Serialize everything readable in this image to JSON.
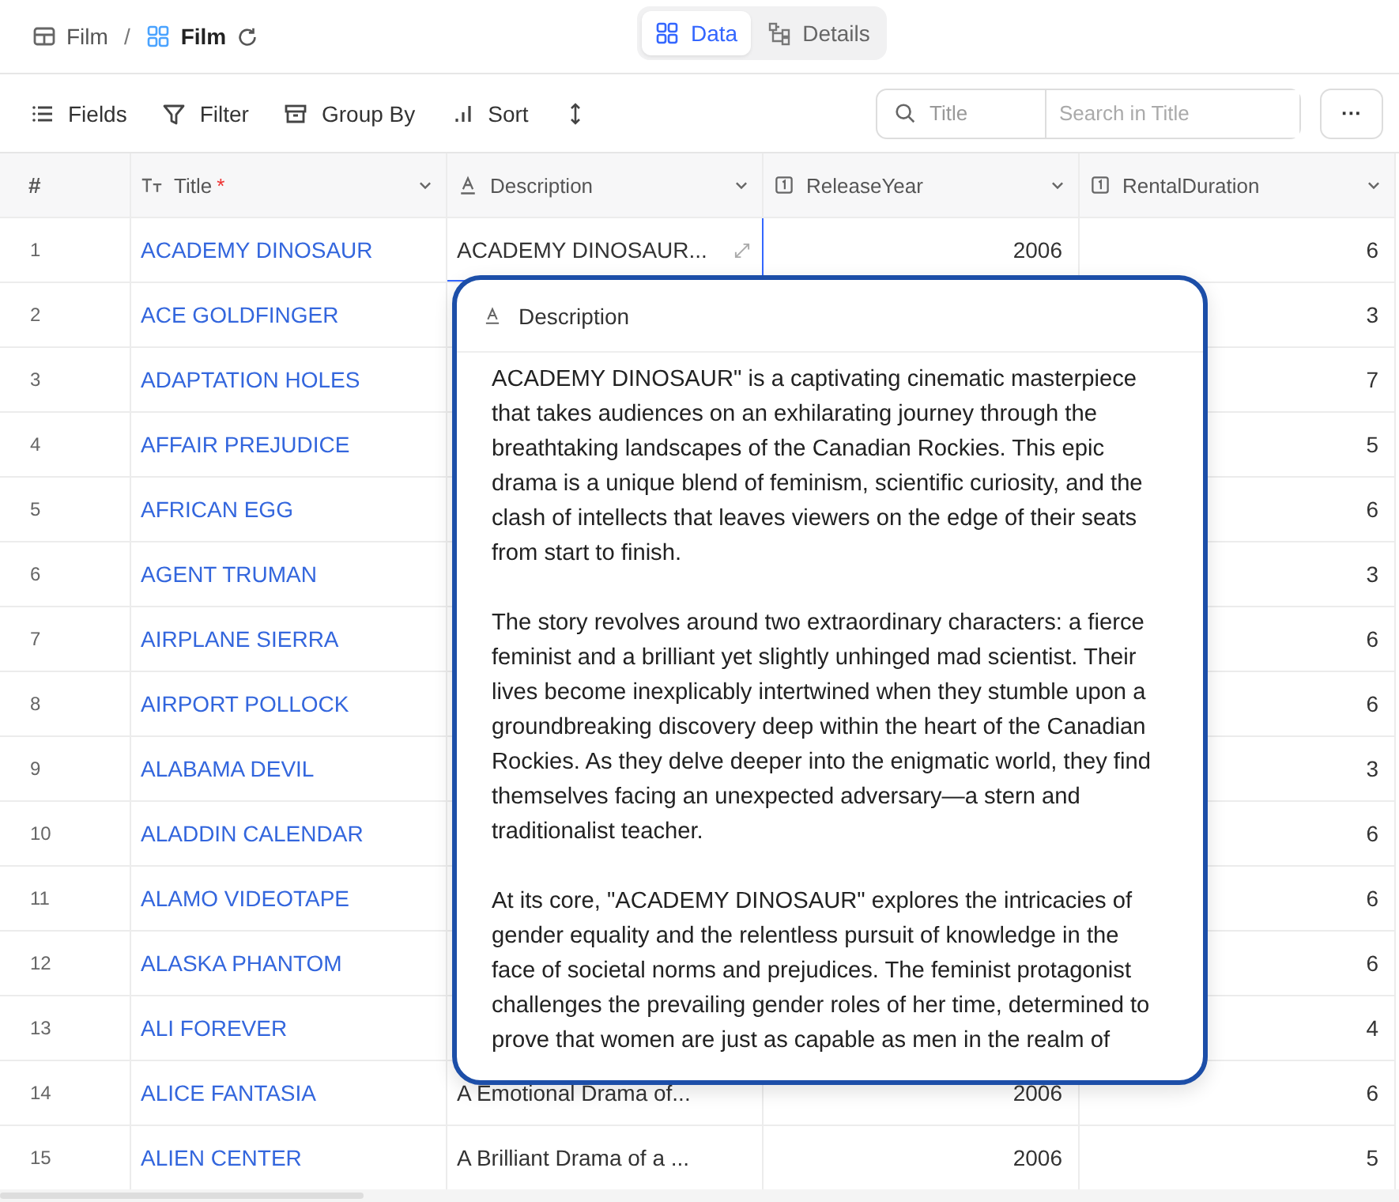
{
  "breadcrumb": {
    "parent": "Film",
    "separator": "/",
    "current": "Film"
  },
  "tabs": [
    {
      "label": "Data",
      "selected": true
    },
    {
      "label": "Details",
      "selected": false
    }
  ],
  "toolbar": [
    "Fields",
    "Filter",
    "Group By",
    "Sort"
  ],
  "search": {
    "field": "Title",
    "placeholder": "Search in Title",
    "more": "···"
  },
  "table": {
    "columns": [
      {
        "label": "#",
        "kind": "index"
      },
      {
        "label": "Title",
        "kind": "title",
        "required": "*"
      },
      {
        "label": "Description",
        "kind": "text"
      },
      {
        "label": "ReleaseYear",
        "kind": "number"
      },
      {
        "label": "RentalDuration",
        "kind": "number"
      }
    ],
    "rows": [
      {
        "num": "1",
        "title": "ACADEMY DINOSAUR",
        "description": "ACADEMY DINOSAUR...",
        "release_year": "2006",
        "rental_duration": "6",
        "selected": true
      },
      {
        "num": "2",
        "title": "ACE GOLDFINGER",
        "rental_duration": "3",
        "selected": false
      },
      {
        "num": "3",
        "title": "ADAPTATION HOLES",
        "rental_duration": "7",
        "selected": false
      },
      {
        "num": "4",
        "title": "AFFAIR PREJUDICE",
        "rental_duration": "5",
        "selected": false
      },
      {
        "num": "5",
        "title": "AFRICAN EGG",
        "rental_duration": "6",
        "selected": false
      },
      {
        "num": "6",
        "title": "AGENT TRUMAN",
        "rental_duration": "3",
        "selected": false
      },
      {
        "num": "7",
        "title": "AIRPLANE SIERRA",
        "rental_duration": "6",
        "selected": false
      },
      {
        "num": "8",
        "title": "AIRPORT POLLOCK",
        "rental_duration": "6",
        "selected": false
      },
      {
        "num": "9",
        "title": "ALABAMA DEVIL",
        "rental_duration": "3",
        "selected": false
      },
      {
        "num": "10",
        "title": "ALADDIN CALENDAR",
        "rental_duration": "6",
        "selected": false
      },
      {
        "num": "11",
        "title": "ALAMO VIDEOTAPE",
        "rental_duration": "6",
        "selected": false
      },
      {
        "num": "12",
        "title": "ALASKA PHANTOM",
        "rental_duration": "6",
        "selected": false
      },
      {
        "num": "13",
        "title": "ALI FOREVER",
        "rental_duration": "4",
        "selected": false
      },
      {
        "num": "14",
        "title": "ALICE FANTASIA",
        "description": "A Emotional Drama of...",
        "release_year": "2006",
        "rental_duration": "6",
        "selected": false
      },
      {
        "num": "15",
        "title": "ALIEN CENTER",
        "description": "A Brilliant Drama of a ...",
        "release_year": "2006",
        "rental_duration": "5",
        "selected": false
      }
    ]
  },
  "popup": {
    "title": "Description",
    "paragraphs": [
      "ACADEMY DINOSAUR\" is a captivating cinematic masterpiece that takes audiences on an exhilarating journey through the breathtaking landscapes of the Canadian Rockies. This epic drama is a unique blend of feminism, scientific curiosity, and the clash of intellects that leaves viewers on the edge of their seats from start to finish.",
      "The story revolves around two extraordinary characters: a fierce feminist and a brilliant yet slightly unhinged mad scientist. Their lives become inexplicably intertwined when they stumble upon a groundbreaking discovery deep within the heart of the Canadian Rockies. As they delve deeper into the enigmatic world, they find themselves facing an unexpected adversary—a stern and traditionalist teacher.",
      "At its core, \"ACADEMY DINOSAUR\" explores the intricacies of gender equality and the relentless pursuit of knowledge in the face of societal norms and prejudices. The feminist protagonist challenges the prevailing gender roles of her time, determined to prove that women are just as capable as men in the realm of"
    ]
  }
}
